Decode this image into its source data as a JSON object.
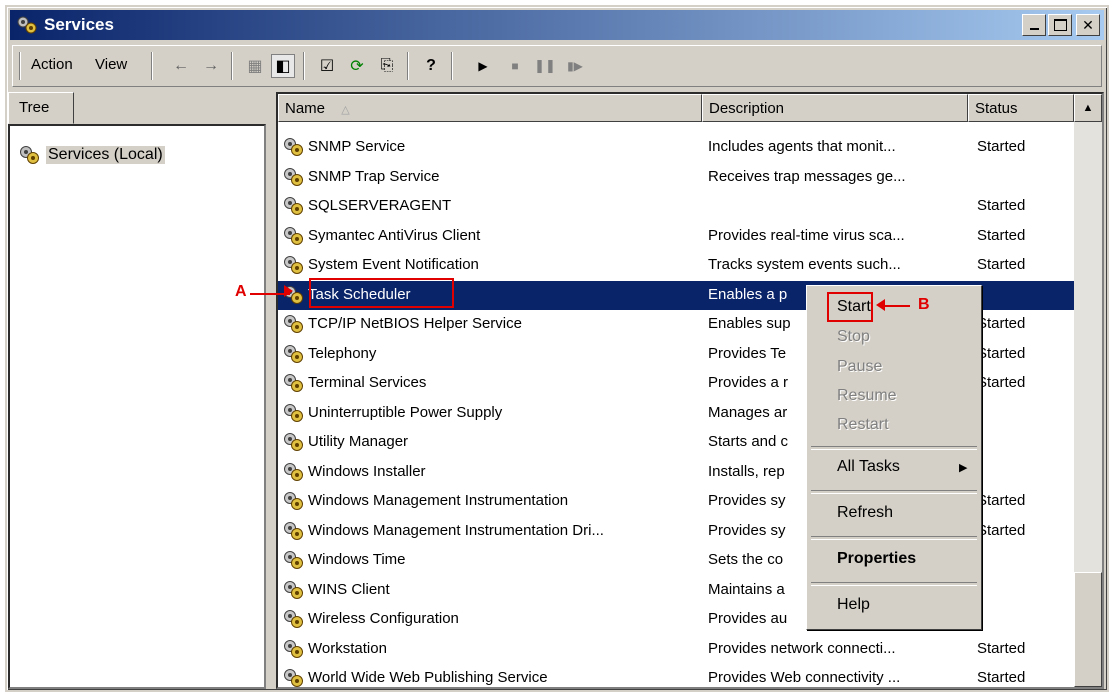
{
  "window": {
    "title": "Services"
  },
  "menu": {
    "action": "Action",
    "view": "View"
  },
  "toolbar_icons": [
    "back-icon",
    "forward-icon",
    "up-icon",
    "show-hide-tree-icon",
    "properties-icon",
    "refresh-icon",
    "export-list-icon",
    "help-icon",
    "play-icon",
    "stop-icon",
    "pause-icon",
    "resume-icon"
  ],
  "tree": {
    "tab": "Tree",
    "root": "Services (Local)"
  },
  "columns": {
    "name": "Name",
    "description": "Description",
    "status": "Status"
  },
  "services": [
    {
      "name": "SNMP Service",
      "description": "Includes agents that monit...",
      "status": "Started"
    },
    {
      "name": "SNMP Trap Service",
      "description": "Receives trap messages ge...",
      "status": ""
    },
    {
      "name": "SQLSERVERAGENT",
      "description": "",
      "status": "Started"
    },
    {
      "name": "Symantec AntiVirus Client",
      "description": "Provides real-time virus sca...",
      "status": "Started"
    },
    {
      "name": "System Event Notification",
      "description": "Tracks system events such...",
      "status": "Started"
    },
    {
      "name": "Task Scheduler",
      "description": "Enables a p",
      "status": ""
    },
    {
      "name": "TCP/IP NetBIOS Helper Service",
      "description": "Enables sup",
      "status": "Started"
    },
    {
      "name": "Telephony",
      "description": "Provides Te",
      "status": "Started"
    },
    {
      "name": "Terminal Services",
      "description": "Provides a r",
      "status": "Started"
    },
    {
      "name": "Uninterruptible Power Supply",
      "description": "Manages ar",
      "status": ""
    },
    {
      "name": "Utility Manager",
      "description": "Starts and c",
      "status": ""
    },
    {
      "name": "Windows Installer",
      "description": "Installs, rep",
      "status": ""
    },
    {
      "name": "Windows Management Instrumentation",
      "description": "Provides sy",
      "status": "Started"
    },
    {
      "name": "Windows Management Instrumentation Dri...",
      "description": "Provides sy",
      "status": "Started"
    },
    {
      "name": "Windows Time",
      "description": "Sets the co",
      "status": ""
    },
    {
      "name": "WINS Client",
      "description": "Maintains a",
      "status": ""
    },
    {
      "name": "Wireless Configuration",
      "description": "Provides au",
      "status": ""
    },
    {
      "name": "Workstation",
      "description": "Provides network connecti...",
      "status": "Started"
    },
    {
      "name": "World Wide Web Publishing Service",
      "description": "Provides Web connectivity ...",
      "status": "Started"
    }
  ],
  "context_menu": {
    "start": "Start",
    "stop": "Stop",
    "pause": "Pause",
    "resume": "Resume",
    "restart": "Restart",
    "all_tasks": "All Tasks",
    "refresh": "Refresh",
    "properties": "Properties",
    "help": "Help"
  },
  "annotations": {
    "a": "A",
    "b": "B"
  },
  "colors": {
    "selection": "#0a246a",
    "annotation": "#e00000"
  }
}
